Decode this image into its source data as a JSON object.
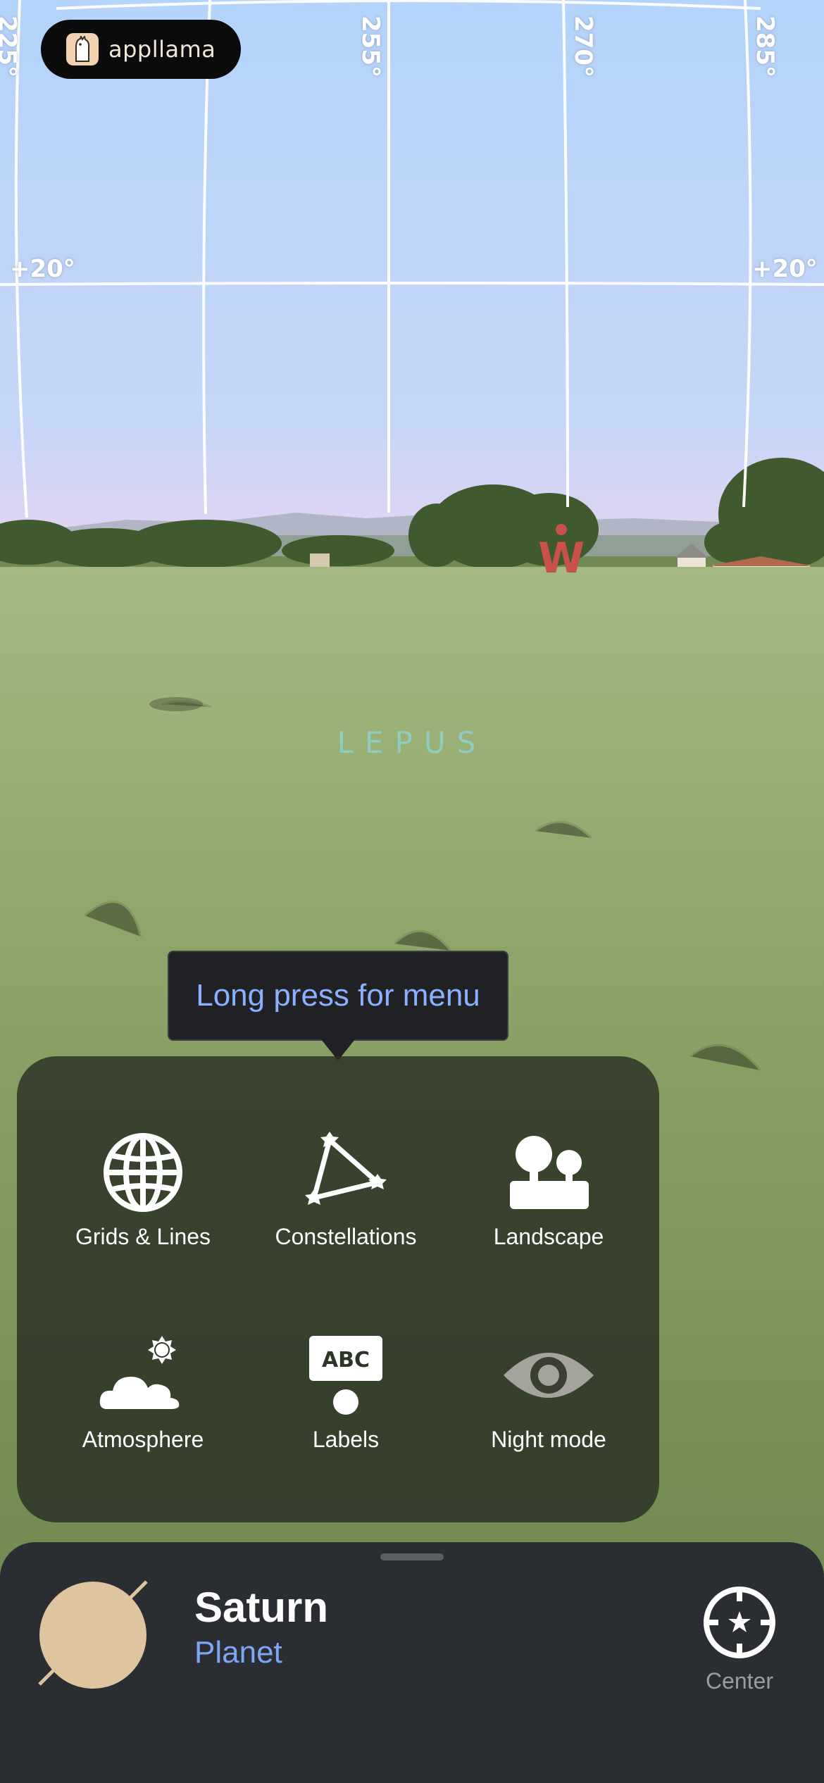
{
  "brand": {
    "name": "appllama",
    "icon": "llama-icon"
  },
  "sky_grid": {
    "azimuth_labels": [
      "225°",
      "255°",
      "270°",
      "285°"
    ],
    "altitude_labels": [
      "+20°",
      "+20°"
    ],
    "compass_mark": "W",
    "constellation": "LEPUS"
  },
  "tooltip": {
    "text": "Long press for menu"
  },
  "quick_menu": {
    "items": [
      {
        "label": "Grids & Lines",
        "icon": "globe-grid-icon"
      },
      {
        "label": "Constellations",
        "icon": "constellation-icon"
      },
      {
        "label": "Landscape",
        "icon": "landscape-trees-icon"
      },
      {
        "label": "Atmosphere",
        "icon": "cloud-sun-icon"
      },
      {
        "label": "Labels",
        "icon": "abc-label-icon"
      },
      {
        "label": "Night mode",
        "icon": "eye-icon"
      }
    ]
  },
  "selected_object": {
    "name": "Saturn",
    "type": "Planet",
    "center_label": "Center",
    "icon": "saturn-icon"
  },
  "colors": {
    "accent_blue": "#7ba7f5",
    "sheet_bg": "#2a2d31",
    "compass_red": "#c9504b"
  }
}
